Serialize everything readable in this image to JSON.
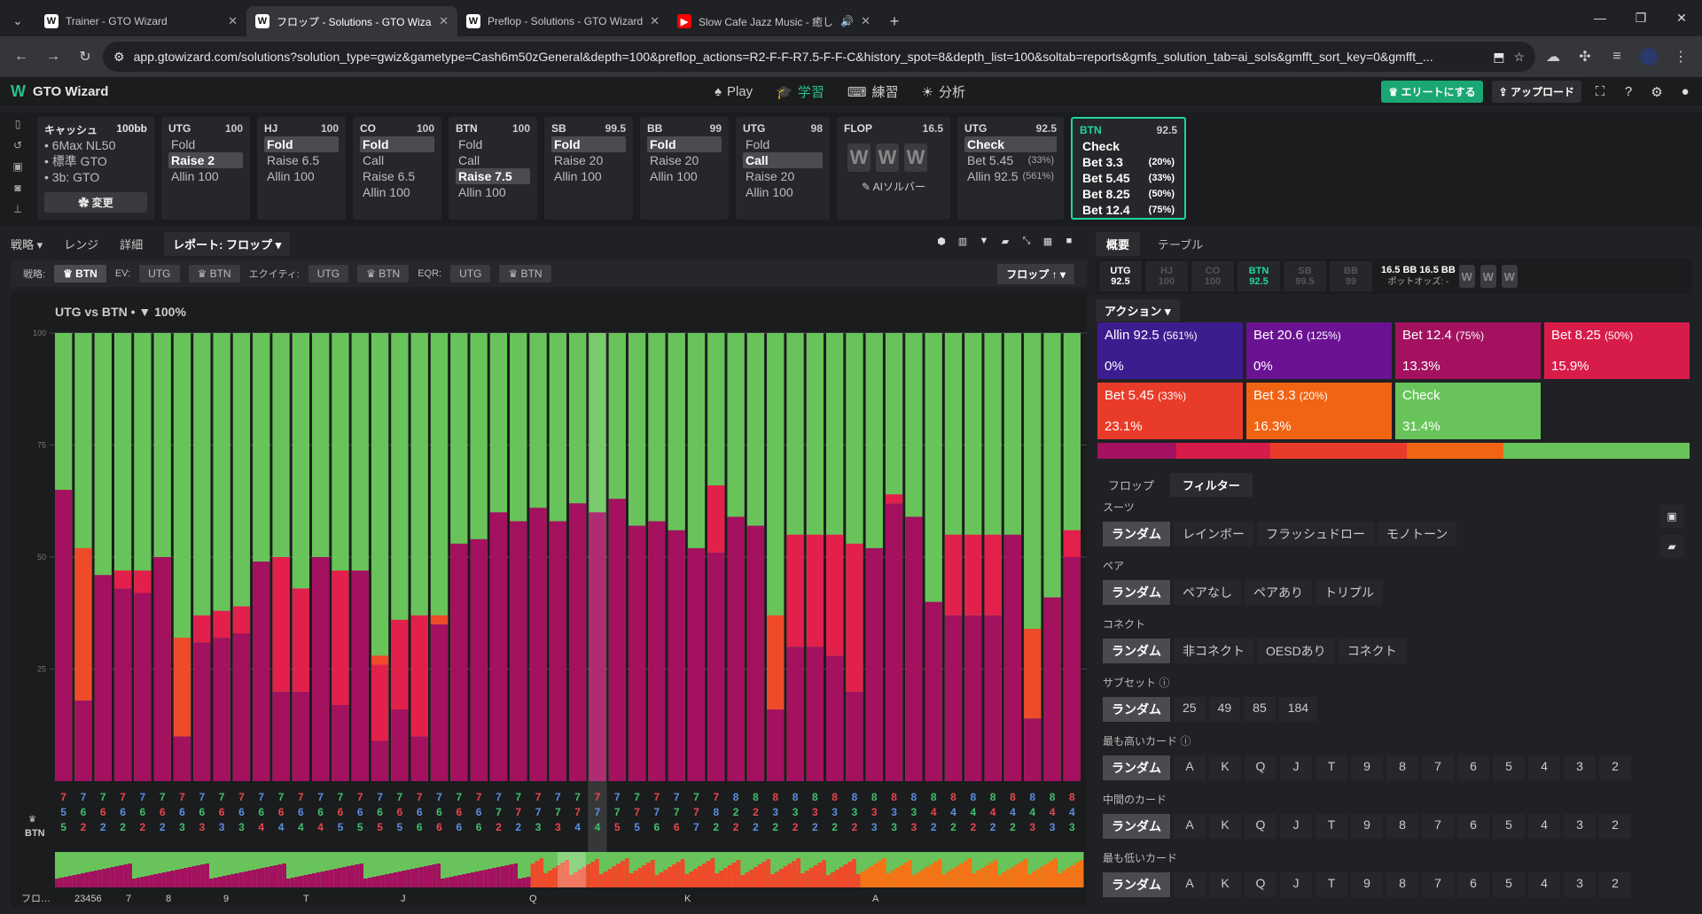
{
  "browser": {
    "tabs": [
      {
        "title": "Trainer - GTO Wizard",
        "icon": "W"
      },
      {
        "title": "フロップ - Solutions - GTO Wizard",
        "icon": "W",
        "active": true
      },
      {
        "title": "Preflop - Solutions - GTO Wizard",
        "icon": "W"
      },
      {
        "title": "Slow Cafe Jazz Music - 癒し",
        "icon": "yt"
      }
    ],
    "url": "app.gtowizard.com/solutions?solution_type=gwiz&gametype=Cash6m50zGeneral&depth=100&preflop_actions=R2-F-F-R7.5-F-F-C&history_spot=8&depth_list=100&soltab=reports&gmfs_solution_tab=ai_sols&gmfft_sort_key=0&gmfft_..."
  },
  "app": {
    "logo": "GTO Wizard",
    "nav": [
      "Play",
      "学習",
      "練習",
      "分析"
    ],
    "elite": "エリートにする",
    "upload": "アップロード"
  },
  "game": {
    "title": "キャッシュ",
    "stack": "100bb",
    "lines": [
      "• 6Max NL50",
      "• 標準 GTO",
      "• 3b: GTO"
    ],
    "change": "✿ 変更"
  },
  "spots": [
    {
      "pos": "UTG",
      "stack": "100",
      "rows": [
        "Fold",
        "Raise 2",
        "Allin 100"
      ],
      "sel": 1
    },
    {
      "pos": "HJ",
      "stack": "100",
      "rows": [
        "Fold",
        "Raise 6.5",
        "Allin 100"
      ],
      "sel": 0
    },
    {
      "pos": "CO",
      "stack": "100",
      "rows": [
        "Fold",
        "Call",
        "Raise 6.5",
        "Allin 100"
      ],
      "sel": 0
    },
    {
      "pos": "BTN",
      "stack": "100",
      "rows": [
        "Fold",
        "Call",
        "Raise 7.5",
        "Allin 100"
      ],
      "sel": 2
    },
    {
      "pos": "SB",
      "stack": "99.5",
      "rows": [
        "Fold",
        "Raise 20",
        "Allin 100"
      ],
      "sel": 0
    },
    {
      "pos": "BB",
      "stack": "99",
      "rows": [
        "Fold",
        "Raise 20",
        "Allin 100"
      ],
      "sel": 0
    },
    {
      "pos": "UTG",
      "stack": "98",
      "rows": [
        "Fold",
        "Call",
        "Raise 20",
        "Allin 100"
      ],
      "sel": 1
    }
  ],
  "flop": {
    "label": "FLOP",
    "pot": "16.5",
    "ai": "✎ AIソルバー"
  },
  "utg_spot": {
    "pos": "UTG",
    "stack": "92.5",
    "rows": [
      {
        "a": "Check",
        "p": ""
      },
      {
        "a": "Bet 5.45",
        "p": "(33%)"
      },
      {
        "a": "Allin 92.5",
        "p": "(561%)"
      }
    ]
  },
  "btn_spot": {
    "pos": "BTN",
    "stack": "92.5",
    "rows": [
      {
        "a": "Check",
        "p": ""
      },
      {
        "a": "Bet 3.3",
        "p": "(20%)"
      },
      {
        "a": "Bet 5.45",
        "p": "(33%)"
      },
      {
        "a": "Bet 8.25",
        "p": "(50%)"
      },
      {
        "a": "Bet 12.4",
        "p": "(75%)"
      }
    ]
  },
  "subtabs": [
    "戦略 ▾",
    "レンジ",
    "詳細",
    "レポート: フロップ ▾"
  ],
  "filters": {
    "strategy_label": "戦略:",
    "strategy": "♛ BTN",
    "ev_label": "EV:",
    "ev": [
      "UTG",
      "♛ BTN"
    ],
    "eq_label": "エクイティ:",
    "eq": [
      "UTG",
      "♛ BTN"
    ],
    "eqr_label": "EQR:",
    "eqr": [
      "UTG",
      "♛ BTN"
    ],
    "sort": "フロップ ↑ ▾"
  },
  "chart_title": "UTG vs BTN  •  ▼ 100%",
  "chart_data": {
    "type": "bar",
    "title": "UTG vs BTN",
    "ylim": [
      0,
      100
    ],
    "yticks": [
      25,
      50,
      75,
      100
    ],
    "series_colors": {
      "allin": "#3d1c8f",
      "bet12.4": "#a3115f",
      "bet8.25": "#e3204b",
      "bet5.45": "#ef4a2a",
      "bet3.3": "#f47316",
      "check": "#68c45a"
    },
    "bars": [
      [
        0,
        65,
        0,
        0,
        0
      ],
      [
        0,
        18,
        0,
        34,
        0
      ],
      [
        0,
        46,
        0,
        0,
        0
      ],
      [
        0,
        43,
        4,
        0,
        0
      ],
      [
        0,
        42,
        5,
        0,
        0
      ],
      [
        0,
        50,
        0,
        0,
        0
      ],
      [
        0,
        10,
        0,
        22,
        0
      ],
      [
        0,
        31,
        6,
        0,
        0
      ],
      [
        0,
        32,
        6,
        0,
        0
      ],
      [
        0,
        33,
        6,
        0,
        0
      ],
      [
        0,
        49,
        0,
        0,
        0
      ],
      [
        0,
        20,
        30,
        0,
        0
      ],
      [
        0,
        20,
        23,
        0,
        0
      ],
      [
        0,
        50,
        0,
        0,
        0
      ],
      [
        0,
        17,
        30,
        0,
        0
      ],
      [
        0,
        47,
        0,
        0,
        0
      ],
      [
        0,
        9,
        17,
        2,
        0
      ],
      [
        0,
        16,
        20,
        0,
        0
      ],
      [
        0,
        10,
        27,
        0,
        0
      ],
      [
        0,
        35,
        0,
        2,
        0
      ],
      [
        0,
        53,
        0,
        0,
        0
      ],
      [
        0,
        54,
        0,
        0,
        0
      ],
      [
        0,
        60,
        0,
        0,
        0
      ],
      [
        0,
        58,
        0,
        0,
        0
      ],
      [
        0,
        61,
        0,
        0,
        0
      ],
      [
        0,
        58,
        0,
        0,
        0
      ],
      [
        0,
        62,
        0,
        0,
        0
      ],
      [
        0,
        60,
        0,
        0,
        0
      ],
      [
        0,
        63,
        0,
        0,
        0
      ],
      [
        0,
        57,
        0,
        0,
        0
      ],
      [
        0,
        58,
        0,
        0,
        0
      ],
      [
        0,
        56,
        0,
        0,
        0
      ],
      [
        0,
        52,
        0,
        0,
        0
      ],
      [
        0,
        51,
        15,
        0,
        0
      ],
      [
        0,
        59,
        0,
        0,
        0
      ],
      [
        0,
        57,
        0,
        0,
        0
      ],
      [
        0,
        16,
        0,
        21,
        0
      ],
      [
        0,
        30,
        25,
        0,
        0
      ],
      [
        0,
        30,
        25,
        0,
        0
      ],
      [
        0,
        28,
        27,
        0,
        0
      ],
      [
        0,
        20,
        33,
        0,
        0
      ],
      [
        0,
        52,
        0,
        0,
        0
      ],
      [
        0,
        62,
        2,
        0,
        0
      ],
      [
        0,
        59,
        0,
        0,
        0
      ],
      [
        0,
        40,
        0,
        0,
        0
      ],
      [
        0,
        37,
        18,
        0,
        0
      ],
      [
        0,
        37,
        18,
        0,
        0
      ],
      [
        0,
        37,
        18,
        0,
        0
      ],
      [
        0,
        55,
        0,
        0,
        0
      ],
      [
        0,
        14,
        0,
        20,
        0
      ],
      [
        0,
        41,
        0,
        0,
        0
      ],
      [
        0,
        50,
        6,
        0,
        0
      ]
    ],
    "labels": [
      [
        "7",
        "5",
        "5"
      ],
      [
        "7",
        "6",
        "2"
      ],
      [
        "7",
        "6",
        "2"
      ],
      [
        "7",
        "6",
        "2"
      ],
      [
        "7",
        "6",
        "2"
      ],
      [
        "7",
        "6",
        "2"
      ],
      [
        "7",
        "6",
        "3"
      ],
      [
        "7",
        "6",
        "3"
      ],
      [
        "7",
        "6",
        "3"
      ],
      [
        "7",
        "6",
        "3"
      ],
      [
        "7",
        "6",
        "4"
      ],
      [
        "7",
        "6",
        "4"
      ],
      [
        "7",
        "6",
        "4"
      ],
      [
        "7",
        "6",
        "4"
      ],
      [
        "7",
        "6",
        "5"
      ],
      [
        "7",
        "6",
        "5"
      ],
      [
        "7",
        "6",
        "5"
      ],
      [
        "7",
        "6",
        "5"
      ],
      [
        "7",
        "6",
        "6"
      ],
      [
        "7",
        "6",
        "6"
      ],
      [
        "7",
        "6",
        "6"
      ],
      [
        "7",
        "6",
        "6"
      ],
      [
        "7",
        "7",
        "2"
      ],
      [
        "7",
        "7",
        "2"
      ],
      [
        "7",
        "7",
        "3"
      ],
      [
        "7",
        "7",
        "3"
      ],
      [
        "7",
        "7",
        "4"
      ],
      [
        "7",
        "7",
        "4"
      ],
      [
        "7",
        "7",
        "5"
      ],
      [
        "7",
        "7",
        "5"
      ],
      [
        "7",
        "7",
        "6"
      ],
      [
        "7",
        "7",
        "6"
      ],
      [
        "7",
        "7",
        "7"
      ],
      [
        "7",
        "8",
        "2"
      ],
      [
        "8",
        "2",
        "2"
      ],
      [
        "8",
        "2",
        "2"
      ],
      [
        "8",
        "3",
        "2"
      ],
      [
        "8",
        "3",
        "2"
      ],
      [
        "8",
        "3",
        "2"
      ],
      [
        "8",
        "3",
        "2"
      ],
      [
        "8",
        "3",
        "2"
      ],
      [
        "8",
        "3",
        "3"
      ],
      [
        "8",
        "3",
        "3"
      ],
      [
        "8",
        "3",
        "3"
      ],
      [
        "8",
        "4",
        "2"
      ],
      [
        "8",
        "4",
        "2"
      ],
      [
        "8",
        "4",
        "2"
      ],
      [
        "8",
        "4",
        "2"
      ],
      [
        "8",
        "4",
        "2"
      ],
      [
        "8",
        "4",
        "3"
      ],
      [
        "8",
        "4",
        "3"
      ],
      [
        "8",
        "4",
        "3"
      ]
    ],
    "overview_labels": [
      "23456",
      "7",
      "8",
      "9",
      "T",
      "J",
      "Q",
      "K",
      "A"
    ],
    "axis_label": "BTN",
    "overview_axis": "フロ…"
  },
  "right": {
    "tabs": [
      "概要",
      "テーブル"
    ],
    "positions": [
      {
        "p": "UTG",
        "s": "92.5",
        "st": "on"
      },
      {
        "p": "HJ",
        "s": "100",
        "st": ""
      },
      {
        "p": "CO",
        "s": "100",
        "st": ""
      },
      {
        "p": "BTN",
        "s": "92.5",
        "st": "btn"
      },
      {
        "p": "SB",
        "s": "99.5",
        "st": ""
      },
      {
        "p": "BB",
        "s": "99",
        "st": ""
      }
    ],
    "pot": "16.5 BB  16.5 BB",
    "potodds": "ポットオッズ: -",
    "action_btn": "アクション ▾",
    "actions": [
      {
        "a": "Allin 92.5",
        "p": "(561%)",
        "f": "0%",
        "c": "#3d1c8f"
      },
      {
        "a": "Bet 20.6",
        "p": "(125%)",
        "f": "0%",
        "c": "#6a1292"
      },
      {
        "a": "Bet 12.4",
        "p": "(75%)",
        "f": "13.3%",
        "c": "#a3115f"
      },
      {
        "a": "Bet 8.25",
        "p": "(50%)",
        "f": "15.9%",
        "c": "#d81c4a"
      },
      {
        "a": "Bet 5.45",
        "p": "(33%)",
        "f": "23.1%",
        "c": "#e93b2a"
      },
      {
        "a": "Bet 3.3",
        "p": "(20%)",
        "f": "16.3%",
        "c": "#f06414"
      },
      {
        "a": "Check",
        "p": "",
        "f": "31.4%",
        "c": "#68c45a"
      }
    ],
    "freq": [
      13.3,
      15.9,
      23.1,
      16.3,
      31.4
    ],
    "ftabs": [
      "フロップ",
      "フィルター"
    ],
    "groups": [
      {
        "label": "スーツ",
        "opts": [
          "ランダム",
          "レインボー",
          "フラッシュドロー",
          "モノトーン"
        ]
      },
      {
        "label": "ペア",
        "opts": [
          "ランダム",
          "ペアなし",
          "ペアあり",
          "トリプル"
        ]
      },
      {
        "label": "コネクト",
        "opts": [
          "ランダム",
          "非コネクト",
          "OESDあり",
          "コネクト"
        ]
      },
      {
        "label": "サブセット ⓘ",
        "opts": [
          "ランダム",
          "25",
          "49",
          "85",
          "184"
        ]
      },
      {
        "label": "最も高いカード ⓘ",
        "opts": [
          "ランダム",
          "A",
          "K",
          "Q",
          "J",
          "T",
          "9",
          "8",
          "7",
          "6",
          "5",
          "4",
          "3",
          "2"
        ]
      },
      {
        "label": "中間のカード",
        "opts": [
          "ランダム",
          "A",
          "K",
          "Q",
          "J",
          "T",
          "9",
          "8",
          "7",
          "6",
          "5",
          "4",
          "3",
          "2"
        ]
      },
      {
        "label": "最も低いカード",
        "opts": [
          "ランダム",
          "A",
          "K",
          "Q",
          "J",
          "T",
          "9",
          "8",
          "7",
          "6",
          "5",
          "4",
          "3",
          "2"
        ]
      }
    ]
  }
}
